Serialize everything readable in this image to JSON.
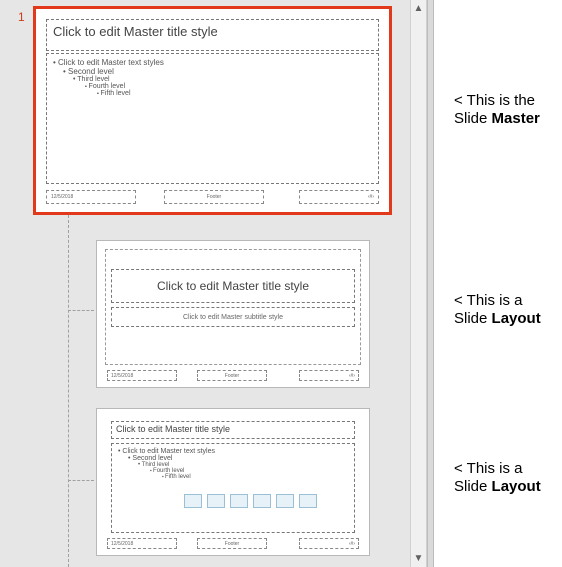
{
  "master": {
    "number": "1",
    "title_placeholder": "Click to edit Master title style",
    "body_levels": {
      "l1": "Click to edit Master text styles",
      "l2": "Second level",
      "l3": "Third level",
      "l4": "Fourth level",
      "l5": "Fifth level"
    },
    "footers": {
      "date": "12/5/2018",
      "center": "Footer",
      "num": "‹#›"
    }
  },
  "layout1": {
    "title_placeholder": "Click to edit Master title style",
    "subtitle_placeholder": "Click to edit Master subtitle style",
    "footers": {
      "date": "12/5/2018",
      "center": "Footer",
      "num": "‹#›"
    }
  },
  "layout2": {
    "title_placeholder": "Click to edit Master title style",
    "body_levels": {
      "l1": "Click to edit Master text styles",
      "l2": "Second level",
      "l3": "Third level",
      "l4": "Fourth level",
      "l5": "Fifth level"
    },
    "icons": [
      "table-icon",
      "chart-icon",
      "smartart-icon",
      "picture-icon",
      "online-pic-icon",
      "video-icon"
    ],
    "footers": {
      "date": "12/5/2018",
      "center": "Footer",
      "num": "‹#›"
    }
  },
  "annotations": {
    "master": {
      "prefix": "< This is the",
      "label_pre": "Slide ",
      "label_bold": "Master"
    },
    "layout1": {
      "prefix": "< This is a",
      "label_pre": "Slide ",
      "label_bold": "Layout"
    },
    "layout2": {
      "prefix": "< This is a",
      "label_pre": "Slide ",
      "label_bold": "Layout"
    }
  }
}
